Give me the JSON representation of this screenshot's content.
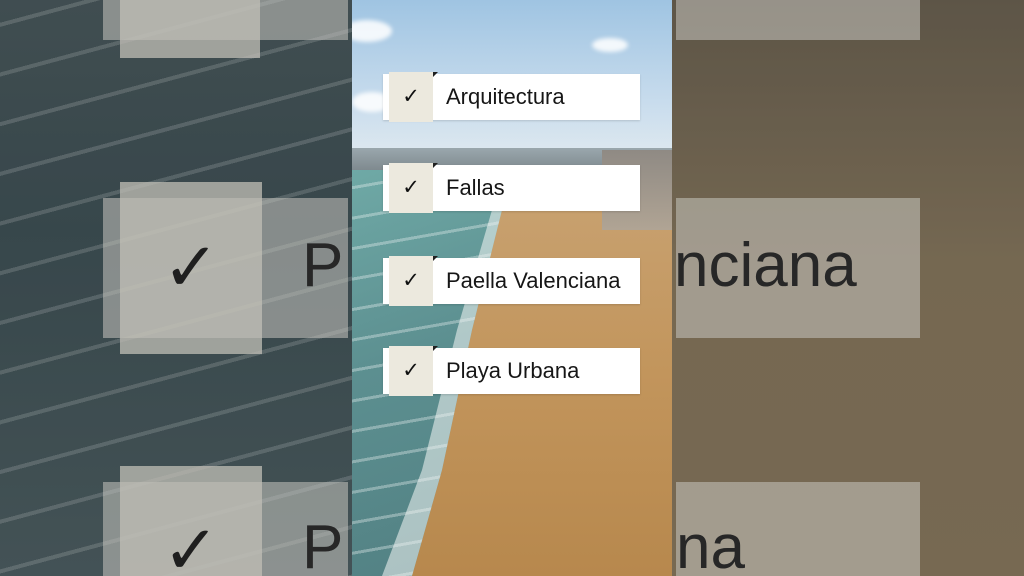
{
  "checklist": {
    "items": [
      {
        "label": "Arquitectura",
        "check": "✓"
      },
      {
        "label": "Fallas",
        "check": "✓"
      },
      {
        "label": "Paella Valenciana",
        "check": "✓"
      },
      {
        "label": "Playa Urbana",
        "check": "✓"
      }
    ]
  },
  "background": {
    "label_left": "P",
    "label_right_1": "nciana",
    "label_right_2": "na",
    "check": "✓"
  },
  "colors": {
    "card": "#ffffff",
    "check_box": "#ece9de",
    "text": "#161616"
  }
}
